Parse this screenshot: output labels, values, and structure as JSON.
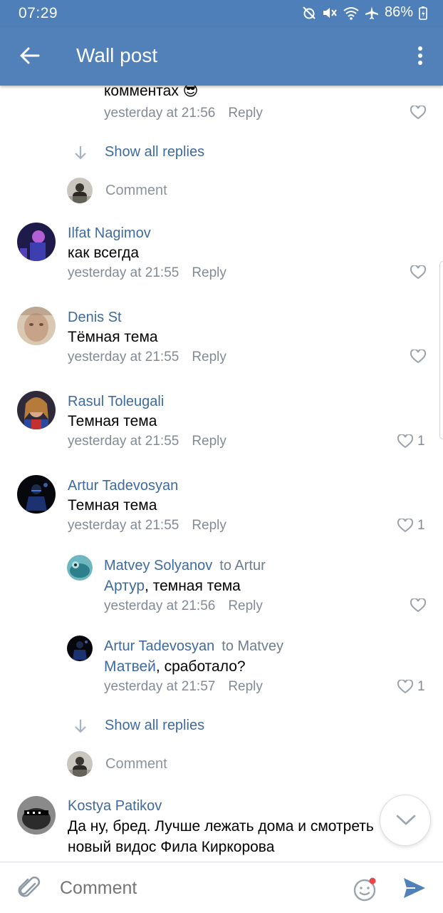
{
  "status_bar": {
    "time": "07:29",
    "battery": "86%"
  },
  "app_bar": {
    "title": "Wall post"
  },
  "thread_top": {
    "partial_text": "комментах",
    "emoji": "😎",
    "time": "yesterday at 21:56",
    "reply": "Reply"
  },
  "show_all_replies": "Show all replies",
  "comment_action": "Comment",
  "comments": [
    {
      "name": "Ilfat Nagimov",
      "text": "как всегда",
      "time": "yesterday at 21:55",
      "reply": "Reply",
      "likes": ""
    },
    {
      "name": "Denis St",
      "text": "Тёмная тема",
      "time": "yesterday at 21:55",
      "reply": "Reply",
      "likes": ""
    },
    {
      "name": "Rasul Toleugali",
      "text": "Темная тема",
      "time": "yesterday at 21:55",
      "reply": "Reply",
      "likes": "1"
    },
    {
      "name": "Artur Tadevosyan",
      "text": "Темная тема",
      "time": "yesterday at 21:55",
      "reply": "Reply",
      "likes": "1"
    }
  ],
  "replies": [
    {
      "name": "Matvey Solyanov",
      "to": "to Artur",
      "mention": "Артур",
      "text": ", темная тема",
      "time": "yesterday at 21:56",
      "reply": "Reply",
      "likes": ""
    },
    {
      "name": "Artur Tadevosyan",
      "to": "to Matvey",
      "mention": "Матвей",
      "text": ", сработало?",
      "time": "yesterday at 21:57",
      "reply": "Reply",
      "likes": "1"
    }
  ],
  "last_comment": {
    "name": "Kostya Patikov",
    "text_line1": "Да ну, бред. Лучше лежать дома и смотреть",
    "text_line2": "новый видос Фила Киркорова"
  },
  "input": {
    "placeholder": "Comment"
  },
  "colors": {
    "header": "#5181b8",
    "link": "#3f6a9e",
    "meta": "#828b95",
    "send": "#5181b8"
  }
}
